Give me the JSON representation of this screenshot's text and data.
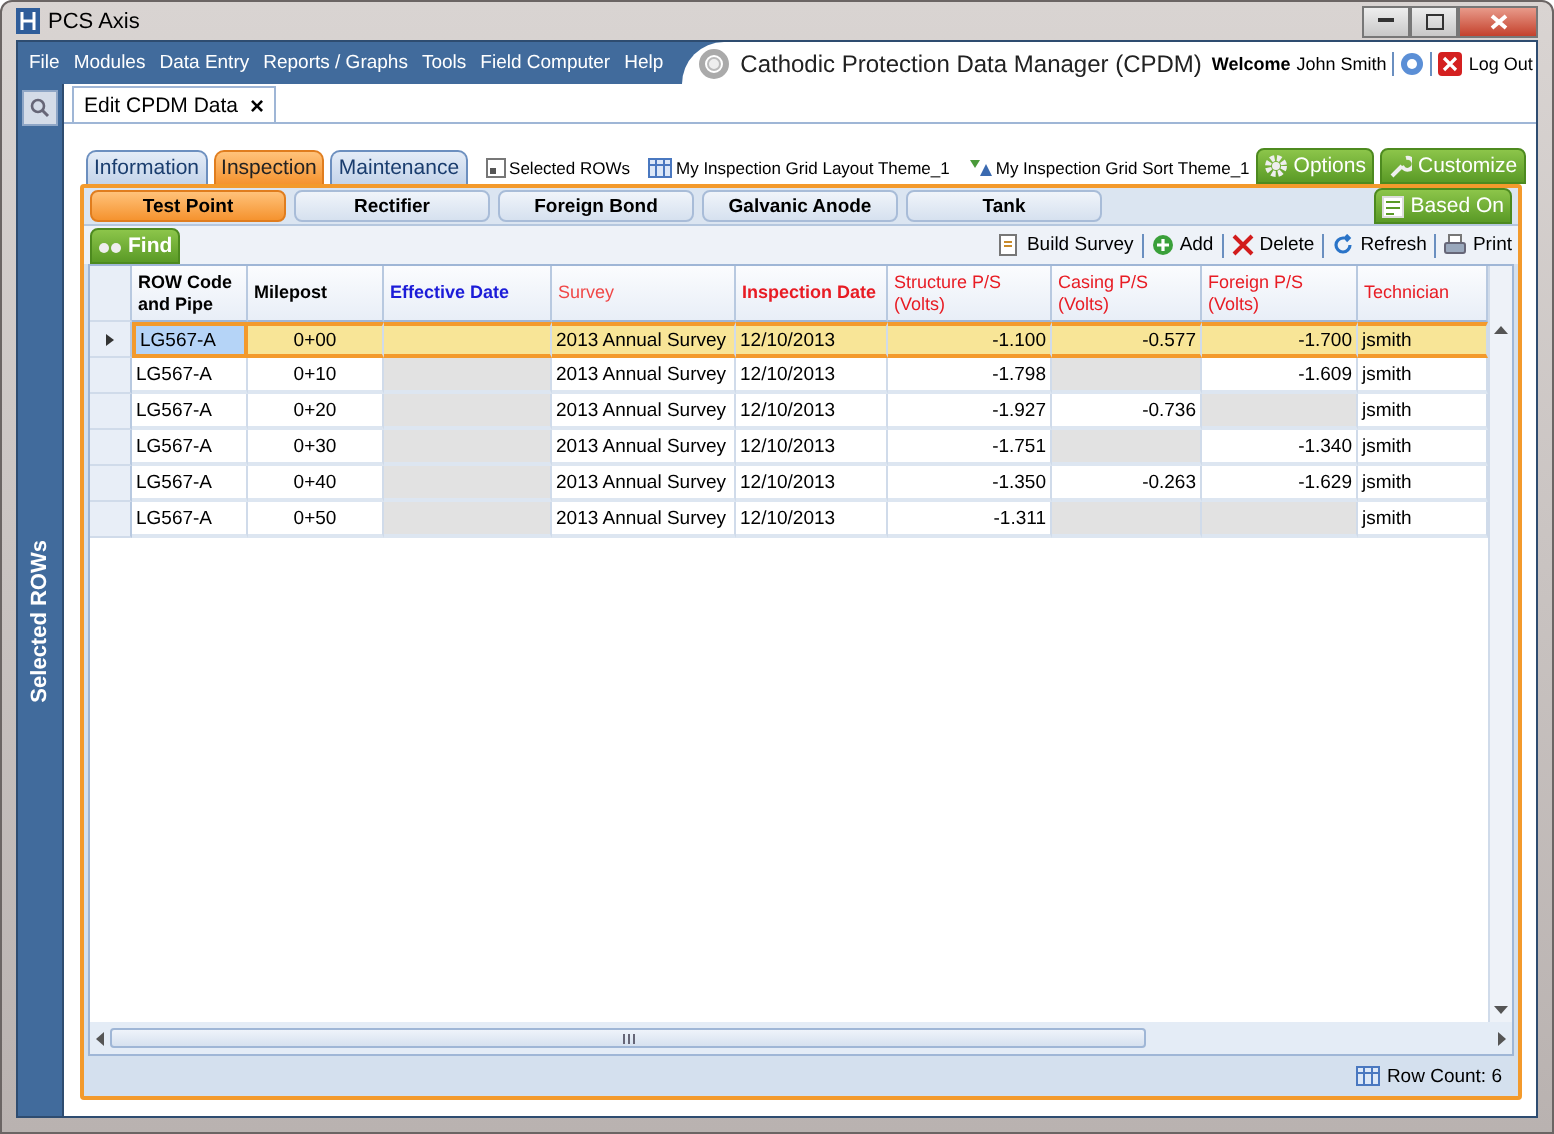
{
  "window": {
    "title": "PCS Axis"
  },
  "menu": [
    "File",
    "Modules",
    "Data Entry",
    "Reports / Graphs",
    "Tools",
    "Field Computer",
    "Help"
  ],
  "app_title": "Cathodic Protection Data Manager (CPDM)",
  "user": {
    "welcome": "Welcome",
    "name": "John Smith",
    "logout": "Log Out"
  },
  "sidebar": {
    "label": "Selected ROWs"
  },
  "doc_tab": {
    "label": "Edit CPDM Data",
    "close": "×"
  },
  "tabs": [
    {
      "label": "Information",
      "selected": false
    },
    {
      "label": "Inspection",
      "selected": true
    },
    {
      "label": "Maintenance",
      "selected": false
    }
  ],
  "themes": [
    {
      "kind": "selection",
      "label": "Selected ROWs"
    },
    {
      "kind": "layout",
      "label": "My Inspection Grid Layout Theme_1"
    },
    {
      "kind": "sort",
      "label": "My Inspection Grid Sort Theme_1"
    }
  ],
  "action_buttons": [
    {
      "kind": "options",
      "label": "Options"
    },
    {
      "kind": "customize",
      "label": "Customize"
    }
  ],
  "subtabs": [
    {
      "label": "Test Point",
      "selected": true
    },
    {
      "label": "Rectifier",
      "selected": false
    },
    {
      "label": "Foreign Bond",
      "selected": false
    },
    {
      "label": "Galvanic Anode",
      "selected": false
    },
    {
      "label": "Tank",
      "selected": false
    }
  ],
  "based_on": "Based On",
  "find": "Find",
  "toolbar": [
    {
      "kind": "build",
      "label": "Build Survey"
    },
    {
      "kind": "add",
      "label": "Add"
    },
    {
      "kind": "delete",
      "label": "Delete"
    },
    {
      "kind": "refresh",
      "label": "Refresh"
    },
    {
      "kind": "print",
      "label": "Print"
    }
  ],
  "table": {
    "columns": [
      {
        "label": "ROW Code and Pipe",
        "color": "#000000",
        "bold": true
      },
      {
        "label": "Milepost",
        "color": "#000000",
        "bold": true
      },
      {
        "label": "Effective Date",
        "color": "#1c1cd8",
        "bold": true
      },
      {
        "label": "Survey",
        "color": "#f04848",
        "bold": false
      },
      {
        "label": "Inspection Date",
        "color": "#e81c24",
        "bold": true
      },
      {
        "label": "Structure P/S (Volts)",
        "color": "#e81c24",
        "bold": false
      },
      {
        "label": "Casing P/S (Volts)",
        "color": "#e81c24",
        "bold": false
      },
      {
        "label": "Foreign P/S (Volts)",
        "color": "#e81c24",
        "bold": false
      },
      {
        "label": "Technician",
        "color": "#e81c24",
        "bold": false
      }
    ],
    "rows": [
      {
        "selected": true,
        "cells": [
          "LG567-A",
          "0+00",
          null,
          "2013 Annual Survey",
          "12/10/2013",
          "-1.100",
          "-0.577",
          "-1.700",
          "jsmith"
        ]
      },
      {
        "selected": false,
        "cells": [
          "LG567-A",
          "0+10",
          null,
          "2013 Annual Survey",
          "12/10/2013",
          "-1.798",
          null,
          "-1.609",
          "jsmith"
        ]
      },
      {
        "selected": false,
        "cells": [
          "LG567-A",
          "0+20",
          null,
          "2013 Annual Survey",
          "12/10/2013",
          "-1.927",
          "-0.736",
          null,
          "jsmith"
        ]
      },
      {
        "selected": false,
        "cells": [
          "LG567-A",
          "0+30",
          null,
          "2013 Annual Survey",
          "12/10/2013",
          "-1.751",
          null,
          "-1.340",
          "jsmith"
        ]
      },
      {
        "selected": false,
        "cells": [
          "LG567-A",
          "0+40",
          null,
          "2013 Annual Survey",
          "12/10/2013",
          "-1.350",
          "-0.263",
          "-1.629",
          "jsmith"
        ]
      },
      {
        "selected": false,
        "cells": [
          "LG567-A",
          "0+50",
          null,
          "2013 Annual Survey",
          "12/10/2013",
          "-1.311",
          null,
          null,
          "jsmith"
        ]
      }
    ]
  },
  "status_bar": {
    "row_count": "Row Count: 6"
  }
}
